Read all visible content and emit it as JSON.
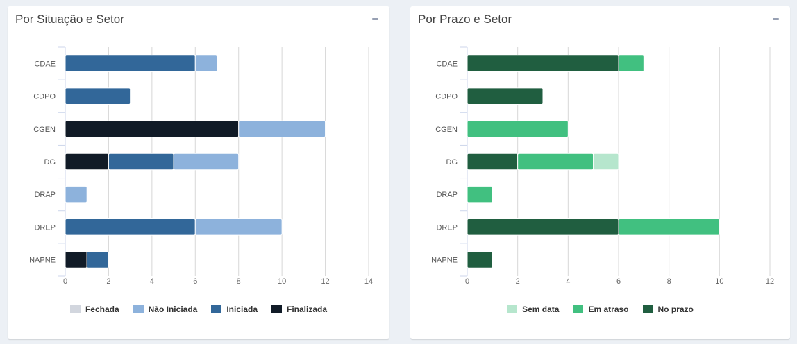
{
  "panels": [
    {
      "title": "Por Situação e Setor",
      "chart_data": {
        "type": "bar",
        "orientation": "horizontal",
        "stacked": true,
        "categories": [
          "CDAE",
          "CDPO",
          "CGEN",
          "DG",
          "DRAP",
          "DREP",
          "NAPNE"
        ],
        "xlim": [
          0,
          14
        ],
        "xticks": [
          0,
          2,
          4,
          6,
          8,
          10,
          12,
          14
        ],
        "grid": true,
        "legend_position": "bottom",
        "series": [
          {
            "name": "Fechada",
            "color": "#d2d6de",
            "values": [
              0,
              0,
              0,
              0,
              0,
              0,
              0
            ]
          },
          {
            "name": "Não Iniciada",
            "color": "#8db2dc",
            "values": [
              1,
              0,
              4,
              3,
              1,
              4,
              0
            ]
          },
          {
            "name": "Iniciada",
            "color": "#326799",
            "values": [
              6,
              3,
              0,
              3,
              0,
              6,
              1
            ]
          },
          {
            "name": "Finalizada",
            "color": "#111b27",
            "values": [
              0,
              0,
              8,
              2,
              0,
              0,
              1
            ]
          }
        ],
        "stack_order": [
          "Finalizada",
          "Iniciada",
          "Não Iniciada",
          "Fechada"
        ]
      }
    },
    {
      "title": "Por Prazo e Setor",
      "chart_data": {
        "type": "bar",
        "orientation": "horizontal",
        "stacked": true,
        "categories": [
          "CDAE",
          "CDPO",
          "CGEN",
          "DG",
          "DRAP",
          "DREP",
          "NAPNE"
        ],
        "xlim": [
          0,
          12
        ],
        "xticks": [
          0,
          2,
          4,
          6,
          8,
          10,
          12
        ],
        "grid": true,
        "legend_position": "bottom",
        "series": [
          {
            "name": "Sem data",
            "color": "#b6e6cd",
            "values": [
              0,
              0,
              0,
              1,
              0,
              0,
              0
            ]
          },
          {
            "name": "Em atraso",
            "color": "#41c080",
            "values": [
              1,
              0,
              4,
              3,
              1,
              4,
              0
            ]
          },
          {
            "name": "No prazo",
            "color": "#205e40",
            "values": [
              6,
              3,
              0,
              2,
              0,
              6,
              1
            ]
          }
        ],
        "stack_order": [
          "No prazo",
          "Em atraso",
          "Sem data"
        ]
      }
    }
  ]
}
